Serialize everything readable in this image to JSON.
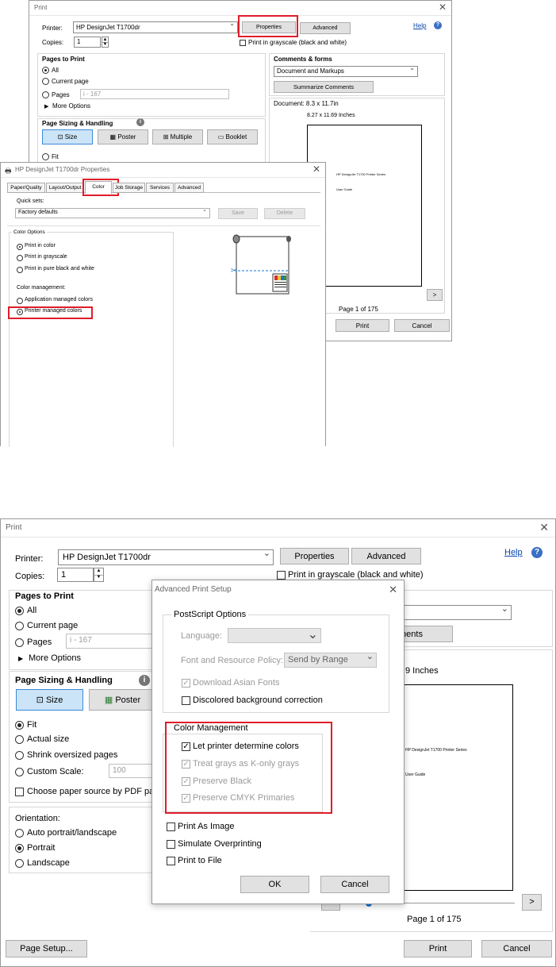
{
  "print1": {
    "title": "Print",
    "printer_label": "Printer:",
    "printer_value": "HP DesignJet T1700dr",
    "properties": "Properties",
    "advanced": "Advanced",
    "help": "Help",
    "copies_label": "Copies:",
    "copies_value": "1",
    "grayscale": "Print in grayscale (black and white)",
    "pages_to_print": "Pages to Print",
    "all": "All",
    "current_page": "Current page",
    "pages": "Pages",
    "pages_value": "i - 167",
    "more_options": "More Options",
    "comments_forms": "Comments & forms",
    "comments_value": "Document and Markups",
    "summarize": "Summarize Comments",
    "document_size": "Document: 8.3 x 11.7in",
    "preview_size": "8.27 x 11.69 Inches",
    "preview_text1": "HP DesignJet T1700 Printer Series",
    "preview_text2": "User Guide",
    "sizing": "Page Sizing & Handling",
    "size": "Size",
    "poster": "Poster",
    "multiple": "Multiple",
    "booklet": "Booklet",
    "fit": "Fit",
    "page_of": "Page 1 of 175",
    "print_btn": "Print",
    "cancel_btn": "Cancel",
    "next": ">"
  },
  "props": {
    "title": "HP DesignJet T1700dr Properties",
    "tabs": [
      "Paper/Quality",
      "Layout/Output",
      "Color",
      "Job Storage",
      "Services",
      "Advanced"
    ],
    "quick_sets": "Quick sets:",
    "quick_value": "Factory defaults",
    "save": "Save",
    "delete": "Delete",
    "color_options": "Color Options",
    "print_color": "Print in color",
    "print_gray": "Print in grayscale",
    "print_bw": "Print in pure black and white",
    "color_mgmt": "Color management:",
    "app_managed": "Application managed colors",
    "printer_managed": "Printer managed colors"
  },
  "print2": {
    "title": "Print",
    "printer_label": "Printer:",
    "printer_value": "HP DesignJet T1700dr",
    "properties": "Properties",
    "advanced": "Advanced",
    "help": "Help",
    "copies_label": "Copies:",
    "copies_value": "1",
    "grayscale": "Print in grayscale (black and white)",
    "pages_to_print": "Pages to Print",
    "all": "All",
    "current_page": "Current page",
    "pages": "Pages",
    "pages_value": "i - 167",
    "more_options": "More Options",
    "comments_partial": "s",
    "summarize_partial": "ments",
    "inches_partial": "9 Inches",
    "preview_text1": "HP DesignJet T1700 Printer Series",
    "preview_text2": "User Guide",
    "sizing": "Page Sizing & Handling",
    "size": "Size",
    "poster": "Poster",
    "fit": "Fit",
    "actual_size": "Actual size",
    "shrink": "Shrink oversized pages",
    "custom_scale": "Custom Scale:",
    "custom_value": "100",
    "paper_source": "Choose paper source by PDF page s",
    "orientation": "Orientation:",
    "auto_portrait": "Auto portrait/landscape",
    "portrait": "Portrait",
    "landscape": "Landscape",
    "page_of": "Page 1 of 175",
    "page_setup": "Page Setup...",
    "print_btn": "Print",
    "cancel_btn": "Cancel",
    "prev": "<",
    "next": ">"
  },
  "adv": {
    "title": "Advanced Print Setup",
    "postscript": "PostScript Options",
    "language": "Language:",
    "font_policy": "Font and Resource Policy:",
    "font_value": "Send by Range",
    "download_fonts": "Download Asian Fonts",
    "discolored": "Discolored background correction",
    "color_management": "Color Management",
    "let_printer": "Let printer determine colors",
    "treat_grays": "Treat grays as K-only grays",
    "preserve_black": "Preserve Black",
    "preserve_cmyk": "Preserve CMYK Primaries",
    "print_image": "Print As Image",
    "simulate": "Simulate Overprinting",
    "print_file": "Print to File",
    "ok": "OK",
    "cancel": "Cancel"
  }
}
